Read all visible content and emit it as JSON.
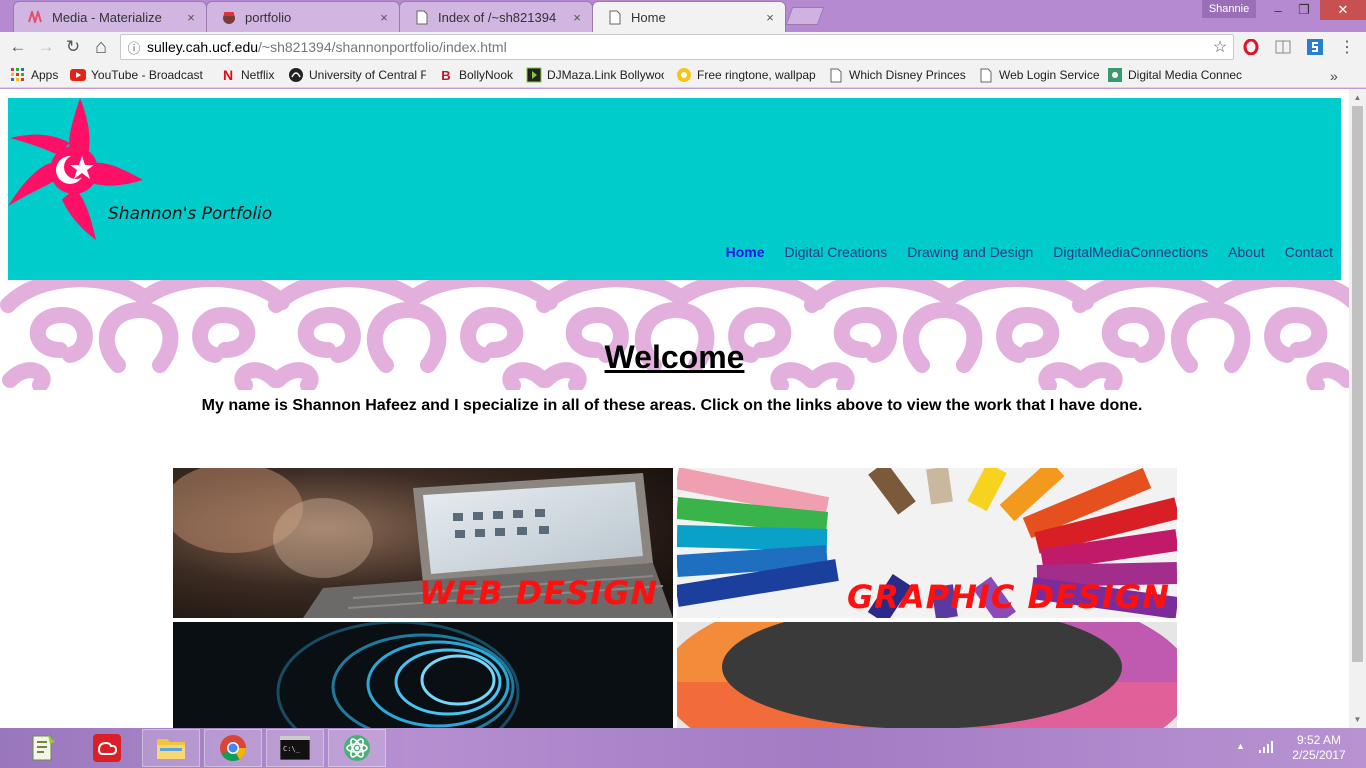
{
  "browser": {
    "tabs": [
      {
        "title": "Media - Materialize",
        "close": "×"
      },
      {
        "title": "portfolio",
        "close": "×"
      },
      {
        "title": "Index of /~sh821394",
        "close": "×"
      },
      {
        "title": "Home",
        "close": "×"
      }
    ],
    "profile_name": "Shannie",
    "window_controls": {
      "minimize": "–",
      "restore": "❐",
      "close": "✕"
    },
    "nav": {
      "back": "←",
      "forward": "→",
      "reload": "↻",
      "home": "⌂"
    },
    "address": {
      "info": "ⓘ",
      "host": "sulley.cah.ucf.edu",
      "path": "/~sh821394/shannonportfolio/index.html",
      "star": "☆"
    },
    "bookmarks": [
      {
        "label": "Apps",
        "icon": "apps-grid-icon"
      },
      {
        "label": "YouTube - Broadcast",
        "icon": "youtube-icon"
      },
      {
        "label": "Netflix",
        "icon": "netflix-icon"
      },
      {
        "label": "University of Central F",
        "icon": "ucf-icon"
      },
      {
        "label": "BollyNook",
        "icon": "bollynook-icon"
      },
      {
        "label": "DJMaza.Link Bollywoo",
        "icon": "djmaza-icon"
      },
      {
        "label": "Free ringtone, wallpap",
        "icon": "ringtone-icon"
      },
      {
        "label": "Which Disney Princess",
        "icon": "page-icon"
      },
      {
        "label": "Web Login Service",
        "icon": "page-icon"
      },
      {
        "label": "Digital Media Connec",
        "icon": "dmc-icon"
      }
    ],
    "bookmarks_more": "»"
  },
  "page": {
    "site_title": "Shannon's Portfolio",
    "nav": [
      "Home",
      "Digital Creations",
      "Drawing and Design",
      "DigitalMediaConnections",
      "About",
      "Contact"
    ],
    "active_nav": "Home",
    "welcome": "Welcome",
    "intro": "My name is Shannon Hafeez and I specialize in all of these areas. Click on the links above to view the work that I have done.",
    "tiles": [
      {
        "label": "WEB DESIGN"
      },
      {
        "label": "GRAPHIC DESIGN"
      },
      {
        "label": ""
      },
      {
        "label": ""
      }
    ],
    "colors": {
      "header_bg": "#00cccc",
      "flower": "#ff1066",
      "swirl": "#e3b0dd",
      "tile_text": "#ff1010",
      "active_link": "#1b17e0"
    }
  },
  "taskbar": {
    "apps": [
      "notepadpp-icon",
      "adobe-cc-icon",
      "file-explorer-icon",
      "chrome-icon",
      "command-prompt-icon",
      "atom-icon"
    ],
    "time": "9:52 AM",
    "date": "2/25/2017",
    "tray_arrow": "▲"
  }
}
